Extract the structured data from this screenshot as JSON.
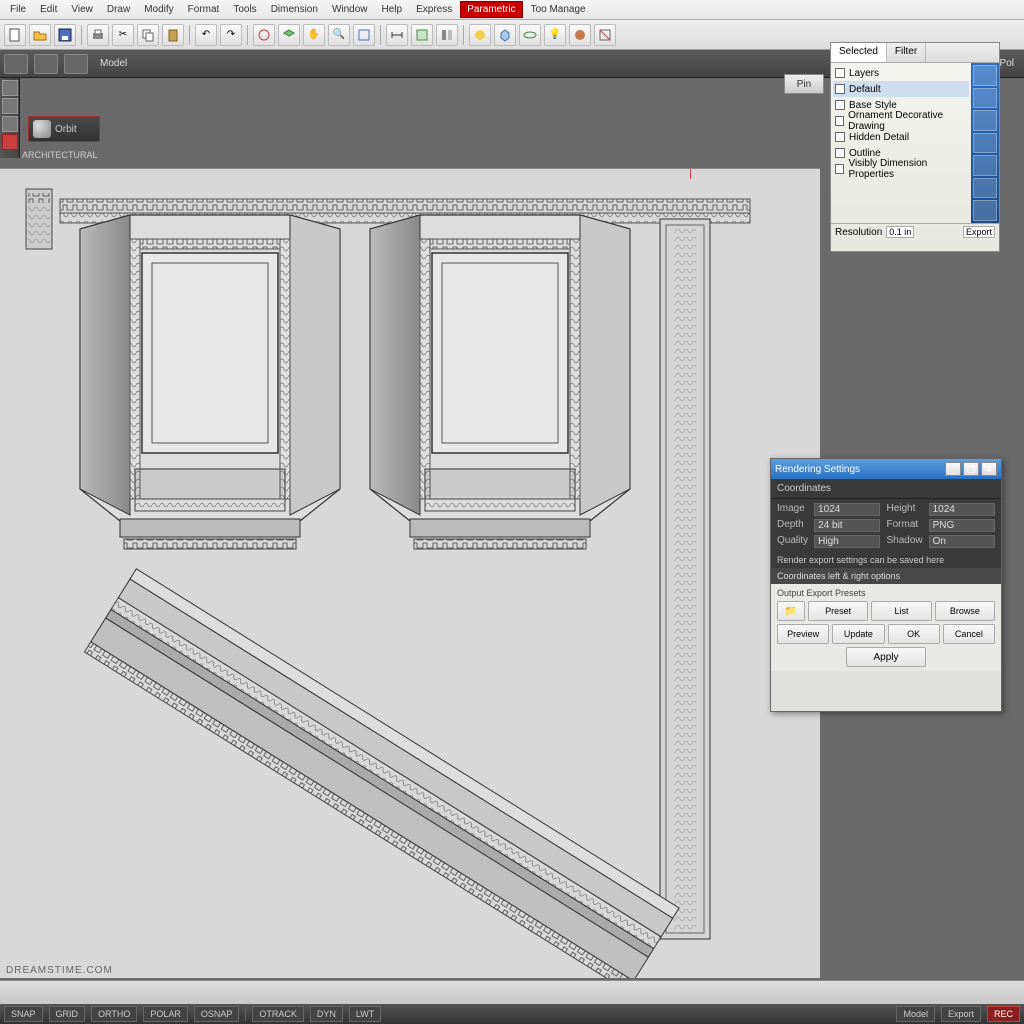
{
  "menubar": {
    "items": [
      "File",
      "Edit",
      "View",
      "Draw",
      "Modify",
      "Format",
      "Tools",
      "Dimension",
      "Window",
      "Help",
      "Express",
      "Parametric",
      "Too Manage"
    ]
  },
  "toolbar_icons": [
    "new",
    "open",
    "save",
    "print",
    "cut",
    "copy",
    "paste",
    "undo",
    "redo",
    "match",
    "layer",
    "pan",
    "zoom",
    "zoom-ext",
    "dist",
    "area",
    "props",
    "render",
    "3d",
    "orbit",
    "light",
    "mat",
    "section",
    "view"
  ],
  "secondary": {
    "mode_label": "Model",
    "right_small": "Pol"
  },
  "left_strip": {
    "items": [
      "home",
      "layers",
      "snap",
      "red"
    ]
  },
  "canvas_tool": {
    "label": "Orbit"
  },
  "info_strip": "ARCHITECTURAL",
  "panel": {
    "tabs": [
      "Selected",
      "Filter"
    ],
    "list": [
      {
        "label": "Layers",
        "sel": false
      },
      {
        "label": "Default",
        "sel": true
      },
      {
        "label": "Base Style",
        "sel": false
      },
      {
        "label": "Ornament Decorative Drawing",
        "sel": false
      },
      {
        "label": "Hidden Detail",
        "sel": false
      },
      {
        "label": "Outline",
        "sel": false
      },
      {
        "label": "Visibly Dimension Properties",
        "sel": false
      }
    ],
    "foot_label": "Resolution",
    "foot_value": "0.1 in",
    "foot_b": "Export"
  },
  "panel_iconcol": [
    "layer",
    "color",
    "line",
    "hatch",
    "dim",
    "text",
    "block"
  ],
  "dialog": {
    "title": "Rendering Settings",
    "section": "Coordinates",
    "rows": [
      {
        "k1": "Image",
        "v1": "1024",
        "k2": "Height",
        "v2": "1024"
      },
      {
        "k1": "Depth",
        "v1": "24 bit",
        "k2": "Format",
        "v2": "PNG"
      },
      {
        "k1": "Quality",
        "v1": "High",
        "k2": "Shadow",
        "v2": "On"
      }
    ],
    "msg": "Render export settings can be saved here",
    "msg2": "Coordinates left & right options",
    "lower_title": "Output Export Presets",
    "buttons_r1": [
      "Preset",
      "List",
      "Browse"
    ],
    "buttons_r2": [
      "Preview",
      "Update",
      "OK",
      "Cancel"
    ],
    "apply": "Apply"
  },
  "right_top_btn": "Pin",
  "watermark": "DREAMSTIME.COM",
  "taskbar": {
    "items": [
      "SNAP",
      "GRID",
      "ORTHO",
      "POLAR",
      "OSNAP",
      "OTRACK",
      "DYN",
      "LWT",
      "Model",
      "Export"
    ],
    "red": "REC"
  }
}
